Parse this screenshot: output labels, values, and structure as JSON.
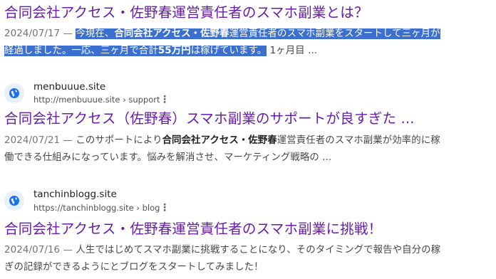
{
  "results": [
    {
      "title": "合同会社アクセス・佐野春運営責任者のスマホ副業とは？",
      "date": "2024/07/17",
      "snippet_line1_before": "今現在、",
      "snippet_line1_bold": "合同会社アクセス・佐野春",
      "snippet_line1_after": "運営責任者のスマホ副業をスタートして三ヶ",
      "snippet_line2_highlight": "月が経過しました。一応、三ヶ月で合計",
      "snippet_line2_bold": "55万円",
      "snippet_line2_highlight_after": "は稼げています。",
      "snippet_line2_tail": "1ヶ月目 ..."
    },
    {
      "site_name": "menbuuue.site",
      "url": "http://menbuuue.site › support",
      "title": "合同会社アクセス（佐野春）スマホ副業のサポートが良すぎた ...",
      "date": "2024/07/21",
      "snippet_before": "このサポートにより",
      "snippet_bold": "合同会社アクセス・佐野春",
      "snippet_after": "運営責任者のスマホ副業が効率的に稼働できる仕組みになっています。悩みを解消させ、マーケティング戦略の ..."
    },
    {
      "site_name": "tanchinblogg.site",
      "url": "https://tanchinblogg.site › blog",
      "title": "合同会社アクセス・佐野春運営責任者のスマホ副業に挑戦！",
      "date": "2024/07/16",
      "snippet": "人生ではじめてスマホ副業に挑戦することになり、そのタイミングで報告や自分の稼ぎの記録ができるようにとブログをスタートしてみました！"
    }
  ],
  "separator": " — ",
  "colors": {
    "title": "#681da8",
    "highlight": "#3b6fd0",
    "favicon_bg": "#e8f0fe",
    "favicon_fg": "#1a73e8"
  },
  "icons": {
    "favicon": "globe-icon",
    "more": "more-vert-icon"
  }
}
